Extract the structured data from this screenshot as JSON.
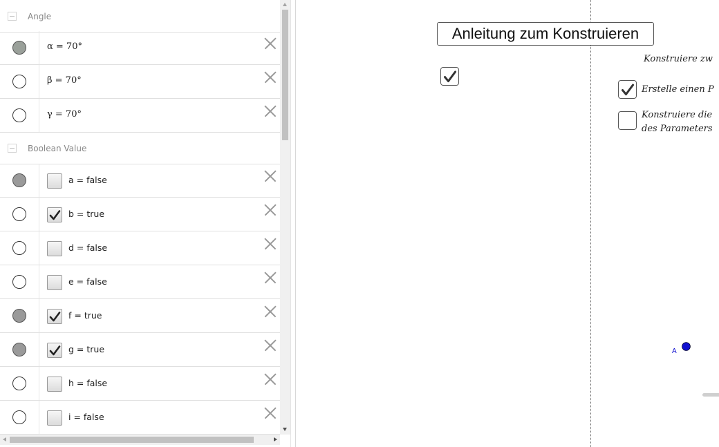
{
  "algebra": {
    "groups": [
      {
        "title": "Angle",
        "items": [
          {
            "expr": "α = 70°",
            "visible": true
          },
          {
            "expr": "β = 70°",
            "visible": false
          },
          {
            "expr": "γ = 70°",
            "visible": false
          }
        ]
      },
      {
        "title": "Boolean Value",
        "items": [
          {
            "expr": "a = false",
            "checked": false,
            "visible": true
          },
          {
            "expr": "b = true",
            "checked": true,
            "visible": false
          },
          {
            "expr": "d = false",
            "checked": false,
            "visible": false
          },
          {
            "expr": "e = false",
            "checked": false,
            "visible": false
          },
          {
            "expr": "f = true",
            "checked": true,
            "visible": true
          },
          {
            "expr": "g = true",
            "checked": true,
            "visible": true
          },
          {
            "expr": "h = false",
            "checked": false,
            "visible": false
          },
          {
            "expr": "i = false",
            "checked": false,
            "visible": false
          }
        ]
      }
    ]
  },
  "graphics": {
    "button_label": "Anleitung zum Konstruieren",
    "checkbox_main_checked": true,
    "instruction_intro": "Konstruiere zw",
    "step1_text": "Erstelle einen P",
    "step1_checked": true,
    "step2_line1": "Konstruiere die",
    "step2_line2": "des Parameters",
    "step2_checked": false,
    "point_label": "A",
    "point_color": "#1010d0"
  },
  "icons": {
    "check": "check-mark-icon",
    "delete": "close-icon",
    "collapse": "collapse-minus-icon"
  }
}
